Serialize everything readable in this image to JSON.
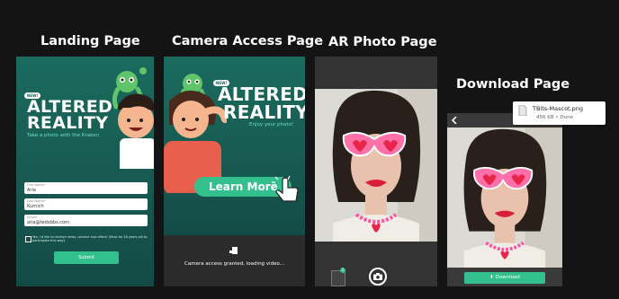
{
  "titles": {
    "landing": "Landing Page",
    "camera": "Camera Access Page",
    "ar": "AR Photo Page",
    "download": "Download Page"
  },
  "landing": {
    "tag": "NEW!",
    "brand_line1": "ALTERED",
    "brand_line2": "REALITY",
    "subtitle": "Take a photo with the Kraken",
    "fields": [
      {
        "label": "First Name*",
        "value": "Aria"
      },
      {
        "label": "Last Name*",
        "value": "Kurnich"
      },
      {
        "label": "Email*",
        "value": "aria@tedxbbs.com"
      }
    ],
    "consent": "Yes, I'd like to receive news, content and offers! (Must be 18 years old to participate this way)",
    "submit": "Submit"
  },
  "camera": {
    "tag": "NEW!",
    "brand_line1": "ALTERED",
    "brand_line2": "REALITY",
    "subtitle": "Enjoy your photo!",
    "learn_more": "Learn More",
    "status": "Camera access granted, loading video..."
  },
  "ar": {
    "gallery_count": "1"
  },
  "download": {
    "toast_filename": "TBits-Mascot.png",
    "toast_meta": "456 KB • Done",
    "button": "Download"
  },
  "colors": {
    "background": "#141414",
    "teal_bg": "#17574f",
    "accent_green": "#33c08e",
    "subtitle_green": "#6fe3c4",
    "glasses_pink": "#ff6fa8",
    "heart_red": "#e8244a"
  }
}
